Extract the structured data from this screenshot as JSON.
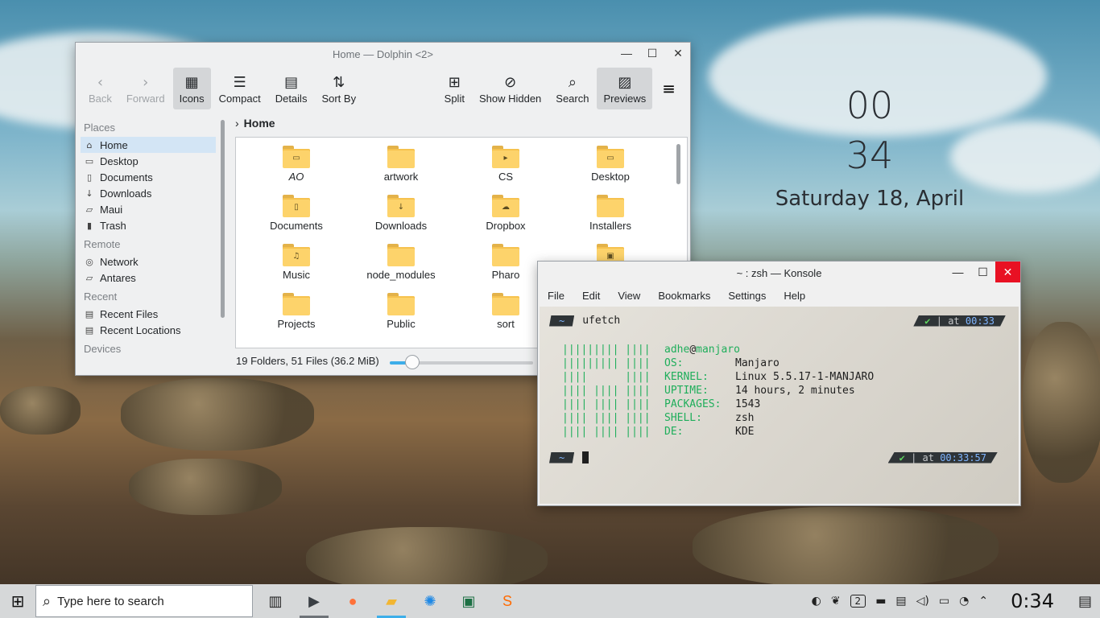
{
  "desktop_clock": {
    "hour": "00",
    "minute": "34",
    "date": "Saturday 18, April"
  },
  "dolphin": {
    "title": "Home — Dolphin <2>",
    "toolbar": [
      {
        "label": "Back",
        "icon": "‹",
        "disabled": true
      },
      {
        "label": "Forward",
        "icon": "›",
        "disabled": true
      },
      {
        "label": "Icons",
        "icon": "▦",
        "active": true
      },
      {
        "label": "Compact",
        "icon": "☰"
      },
      {
        "label": "Details",
        "icon": "▤"
      },
      {
        "label": "Sort By",
        "icon": "⇅"
      },
      {
        "label": "Split",
        "icon": "⊞"
      },
      {
        "label": "Show Hidden",
        "icon": "⊘"
      },
      {
        "label": "Search",
        "icon": "⌕"
      },
      {
        "label": "Previews",
        "icon": "▨",
        "active": true
      }
    ],
    "places": {
      "places_header": "Places",
      "places_items": [
        {
          "label": "Home",
          "icon": "⌂"
        },
        {
          "label": "Desktop",
          "icon": "▭"
        },
        {
          "label": "Documents",
          "icon": "▯"
        },
        {
          "label": "Downloads",
          "icon": "↓"
        },
        {
          "label": "Maui",
          "icon": "▱"
        },
        {
          "label": "Trash",
          "icon": "▮"
        }
      ],
      "remote_header": "Remote",
      "remote_items": [
        {
          "label": "Network",
          "icon": "◎"
        },
        {
          "label": "Antares",
          "icon": "▱"
        }
      ],
      "recent_header": "Recent",
      "recent_items": [
        {
          "label": "Recent Files",
          "icon": "▤"
        },
        {
          "label": "Recent Locations",
          "icon": "▤"
        }
      ],
      "devices_header": "Devices"
    },
    "breadcrumb": "Home",
    "files": [
      {
        "name": "AO",
        "glyph": "▭",
        "italic": true
      },
      {
        "name": "artwork",
        "glyph": ""
      },
      {
        "name": "CS",
        "glyph": "▸"
      },
      {
        "name": "Desktop",
        "glyph": "▭"
      },
      {
        "name": "Documents",
        "glyph": "▯"
      },
      {
        "name": "Downloads",
        "glyph": "↓"
      },
      {
        "name": "Dropbox",
        "glyph": "☁"
      },
      {
        "name": "Installers",
        "glyph": ""
      },
      {
        "name": "Music",
        "glyph": "♫"
      },
      {
        "name": "node_modules",
        "glyph": ""
      },
      {
        "name": "Pharo",
        "glyph": ""
      },
      {
        "name": "",
        "glyph": "▣"
      },
      {
        "name": "Projects",
        "glyph": ""
      },
      {
        "name": "Public",
        "glyph": ""
      },
      {
        "name": "sort",
        "glyph": ""
      },
      {
        "name": "",
        "glyph": ""
      }
    ],
    "status": "19 Folders, 51 Files (36.2 MiB)",
    "zoom_level": 0.16
  },
  "konsole": {
    "title": "~ : zsh — Konsole",
    "menu": [
      "File",
      "Edit",
      "View",
      "Bookmarks",
      "Settings",
      "Help"
    ],
    "prompt_dir": "~",
    "command": "ufetch",
    "right_prompt_1": {
      "check": "✔",
      "text": " | at ",
      "time": "00:33"
    },
    "right_prompt_2": {
      "check": "✔",
      "text": " | at ",
      "time": "00:33:57"
    },
    "logo": "||||||||| ||||\n||||||||| ||||\n||||      ||||\n|||| |||| ||||\n|||| |||| ||||\n|||| |||| ||||\n|||| |||| ||||",
    "user": "adhe",
    "at": "@",
    "host": "manjaro",
    "info": [
      {
        "key": "OS:",
        "value": "Manjaro"
      },
      {
        "key": "KERNEL:",
        "value": "Linux 5.5.17-1-MANJARO"
      },
      {
        "key": "UPTIME:",
        "value": "14 hours, 2 minutes"
      },
      {
        "key": "PACKAGES:",
        "value": "1543"
      },
      {
        "key": "SHELL:",
        "value": "zsh"
      },
      {
        "key": "DE:",
        "value": "KDE"
      }
    ]
  },
  "taskbar": {
    "search_placeholder": "Type here to search",
    "apps": [
      {
        "name": "task-view-icon",
        "glyph": "▥",
        "color": "#222222"
      },
      {
        "name": "terminal-app-icon",
        "glyph": "▶",
        "color": "#3a3f44",
        "running": true
      },
      {
        "name": "firefox-icon",
        "glyph": "●",
        "color": "#ff7139"
      },
      {
        "name": "file-manager-icon",
        "glyph": "▰",
        "color": "#f2b632",
        "running": true,
        "active": true
      },
      {
        "name": "settings-icon",
        "glyph": "✺",
        "color": "#1e88e5"
      },
      {
        "name": "excel-icon",
        "glyph": "▣",
        "color": "#1d7044"
      },
      {
        "name": "sublime-icon",
        "glyph": "S",
        "color": "#ff6a00"
      }
    ],
    "tray_badge": "2",
    "time": "0:34"
  }
}
